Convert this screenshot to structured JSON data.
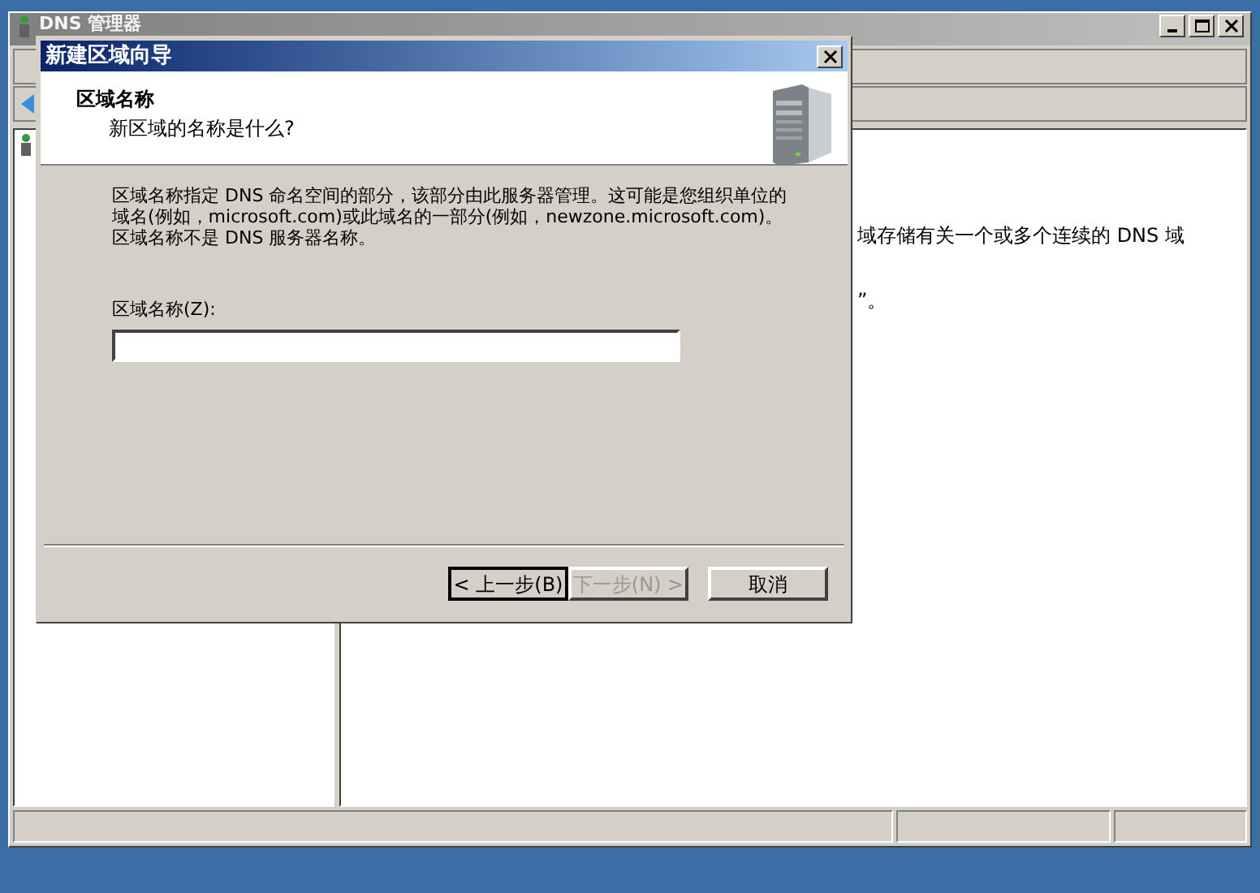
{
  "main_window": {
    "title": "DNS 管理器",
    "details_lines": [
      "域存储有关一个或多个连续的 DNS 域",
      "”。"
    ]
  },
  "dialog": {
    "title": "新建区域向导",
    "heading": "区域名称",
    "subheading": "新区域的名称是什么?",
    "description": "区域名称指定 DNS 命名空间的部分，该部分由此服务器管理。这可能是您组织单位的域名(例如，microsoft.com)或此域名的一部分(例如，newzone.microsoft.com)。区域名称不是 DNS 服务器名称。",
    "field": {
      "label": "区域名称(Z):"
    },
    "buttons": [
      {
        "label": "< 上一步(B)",
        "disabled": false,
        "default": true
      },
      {
        "label": "下一步(N) >",
        "disabled": true,
        "default": false
      },
      {
        "label": "取消",
        "disabled": false,
        "default": false
      }
    ]
  }
}
